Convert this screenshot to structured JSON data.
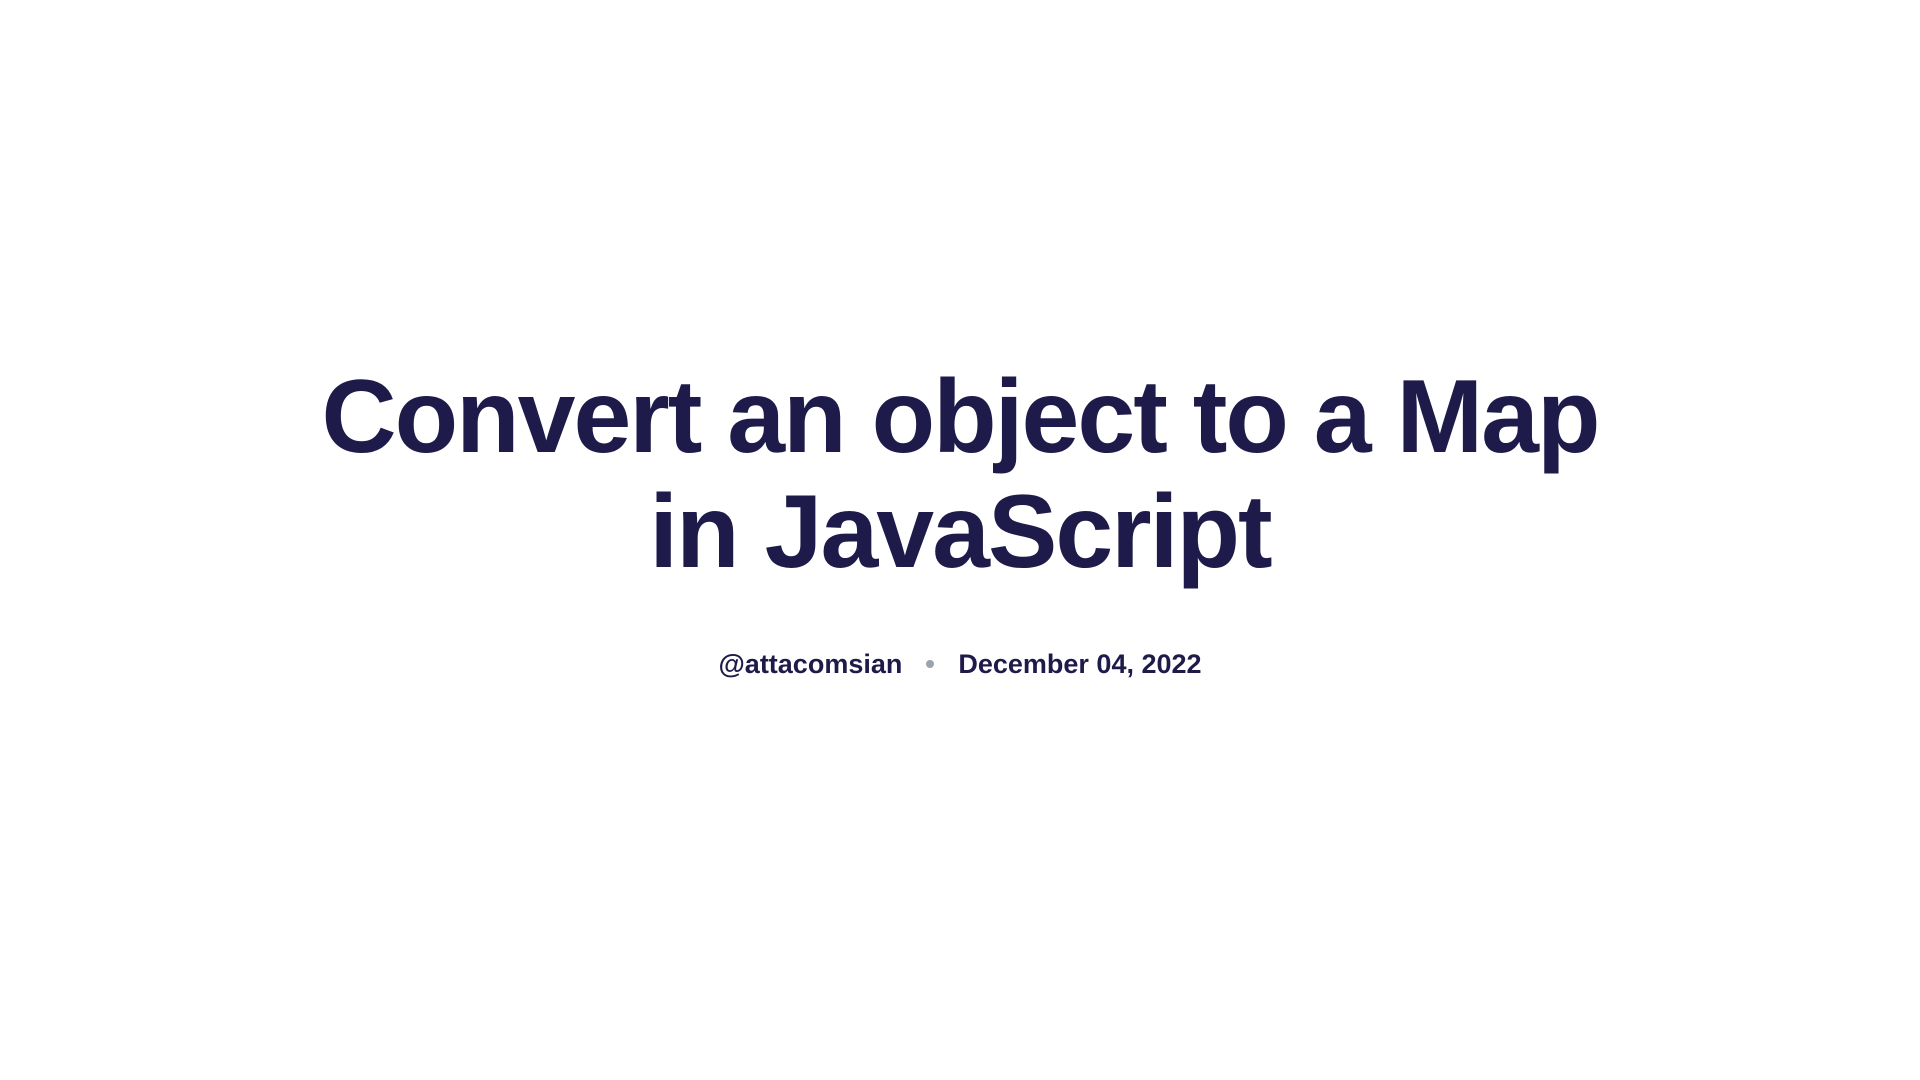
{
  "title": "Convert an object to a Map in JavaScript",
  "author": "@attacomsian",
  "date": "December 04, 2022"
}
